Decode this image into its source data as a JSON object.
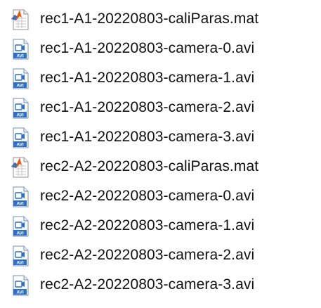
{
  "files": [
    {
      "name": "rec1-A1-20220803-caliParas.mat",
      "icon": "matlab-mat-file-icon"
    },
    {
      "name": "rec1-A1-20220803-camera-0.avi",
      "icon": "avi-video-file-icon"
    },
    {
      "name": "rec1-A1-20220803-camera-1.avi",
      "icon": "avi-video-file-icon"
    },
    {
      "name": "rec1-A1-20220803-camera-2.avi",
      "icon": "avi-video-file-icon"
    },
    {
      "name": "rec1-A1-20220803-camera-3.avi",
      "icon": "avi-video-file-icon"
    },
    {
      "name": "rec2-A2-20220803-caliParas.mat",
      "icon": "matlab-mat-file-icon"
    },
    {
      "name": "rec2-A2-20220803-camera-0.avi",
      "icon": "avi-video-file-icon"
    },
    {
      "name": "rec2-A2-20220803-camera-1.avi",
      "icon": "avi-video-file-icon"
    },
    {
      "name": "rec2-A2-20220803-camera-2.avi",
      "icon": "avi-video-file-icon"
    },
    {
      "name": "rec2-A2-20220803-camera-3.avi",
      "icon": "avi-video-file-icon"
    }
  ],
  "icon_labels": {
    "avi": "AVI"
  },
  "colors": {
    "avi_blue": "#2a6fd0",
    "matlab_orange": "#e35b12",
    "text": "#111111"
  }
}
